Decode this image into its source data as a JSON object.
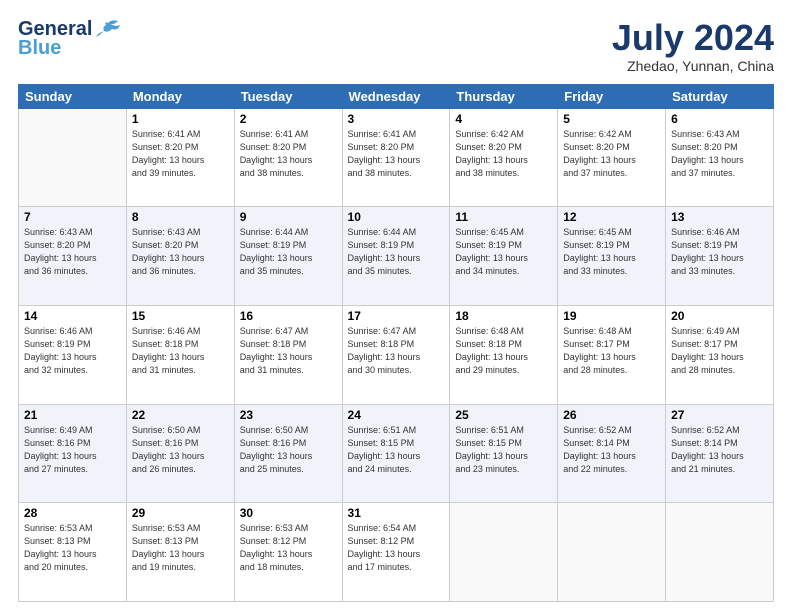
{
  "header": {
    "logo_line1": "General",
    "logo_line2": "Blue",
    "month_title": "July 2024",
    "location": "Zhedao, Yunnan, China"
  },
  "days_of_week": [
    "Sunday",
    "Monday",
    "Tuesday",
    "Wednesday",
    "Thursday",
    "Friday",
    "Saturday"
  ],
  "weeks": [
    [
      {
        "day": "",
        "info": ""
      },
      {
        "day": "1",
        "info": "Sunrise: 6:41 AM\nSunset: 8:20 PM\nDaylight: 13 hours\nand 39 minutes."
      },
      {
        "day": "2",
        "info": "Sunrise: 6:41 AM\nSunset: 8:20 PM\nDaylight: 13 hours\nand 38 minutes."
      },
      {
        "day": "3",
        "info": "Sunrise: 6:41 AM\nSunset: 8:20 PM\nDaylight: 13 hours\nand 38 minutes."
      },
      {
        "day": "4",
        "info": "Sunrise: 6:42 AM\nSunset: 8:20 PM\nDaylight: 13 hours\nand 38 minutes."
      },
      {
        "day": "5",
        "info": "Sunrise: 6:42 AM\nSunset: 8:20 PM\nDaylight: 13 hours\nand 37 minutes."
      },
      {
        "day": "6",
        "info": "Sunrise: 6:43 AM\nSunset: 8:20 PM\nDaylight: 13 hours\nand 37 minutes."
      }
    ],
    [
      {
        "day": "7",
        "info": "Sunrise: 6:43 AM\nSunset: 8:20 PM\nDaylight: 13 hours\nand 36 minutes."
      },
      {
        "day": "8",
        "info": "Sunrise: 6:43 AM\nSunset: 8:20 PM\nDaylight: 13 hours\nand 36 minutes."
      },
      {
        "day": "9",
        "info": "Sunrise: 6:44 AM\nSunset: 8:19 PM\nDaylight: 13 hours\nand 35 minutes."
      },
      {
        "day": "10",
        "info": "Sunrise: 6:44 AM\nSunset: 8:19 PM\nDaylight: 13 hours\nand 35 minutes."
      },
      {
        "day": "11",
        "info": "Sunrise: 6:45 AM\nSunset: 8:19 PM\nDaylight: 13 hours\nand 34 minutes."
      },
      {
        "day": "12",
        "info": "Sunrise: 6:45 AM\nSunset: 8:19 PM\nDaylight: 13 hours\nand 33 minutes."
      },
      {
        "day": "13",
        "info": "Sunrise: 6:46 AM\nSunset: 8:19 PM\nDaylight: 13 hours\nand 33 minutes."
      }
    ],
    [
      {
        "day": "14",
        "info": "Sunrise: 6:46 AM\nSunset: 8:19 PM\nDaylight: 13 hours\nand 32 minutes."
      },
      {
        "day": "15",
        "info": "Sunrise: 6:46 AM\nSunset: 8:18 PM\nDaylight: 13 hours\nand 31 minutes."
      },
      {
        "day": "16",
        "info": "Sunrise: 6:47 AM\nSunset: 8:18 PM\nDaylight: 13 hours\nand 31 minutes."
      },
      {
        "day": "17",
        "info": "Sunrise: 6:47 AM\nSunset: 8:18 PM\nDaylight: 13 hours\nand 30 minutes."
      },
      {
        "day": "18",
        "info": "Sunrise: 6:48 AM\nSunset: 8:18 PM\nDaylight: 13 hours\nand 29 minutes."
      },
      {
        "day": "19",
        "info": "Sunrise: 6:48 AM\nSunset: 8:17 PM\nDaylight: 13 hours\nand 28 minutes."
      },
      {
        "day": "20",
        "info": "Sunrise: 6:49 AM\nSunset: 8:17 PM\nDaylight: 13 hours\nand 28 minutes."
      }
    ],
    [
      {
        "day": "21",
        "info": "Sunrise: 6:49 AM\nSunset: 8:16 PM\nDaylight: 13 hours\nand 27 minutes."
      },
      {
        "day": "22",
        "info": "Sunrise: 6:50 AM\nSunset: 8:16 PM\nDaylight: 13 hours\nand 26 minutes."
      },
      {
        "day": "23",
        "info": "Sunrise: 6:50 AM\nSunset: 8:16 PM\nDaylight: 13 hours\nand 25 minutes."
      },
      {
        "day": "24",
        "info": "Sunrise: 6:51 AM\nSunset: 8:15 PM\nDaylight: 13 hours\nand 24 minutes."
      },
      {
        "day": "25",
        "info": "Sunrise: 6:51 AM\nSunset: 8:15 PM\nDaylight: 13 hours\nand 23 minutes."
      },
      {
        "day": "26",
        "info": "Sunrise: 6:52 AM\nSunset: 8:14 PM\nDaylight: 13 hours\nand 22 minutes."
      },
      {
        "day": "27",
        "info": "Sunrise: 6:52 AM\nSunset: 8:14 PM\nDaylight: 13 hours\nand 21 minutes."
      }
    ],
    [
      {
        "day": "28",
        "info": "Sunrise: 6:53 AM\nSunset: 8:13 PM\nDaylight: 13 hours\nand 20 minutes."
      },
      {
        "day": "29",
        "info": "Sunrise: 6:53 AM\nSunset: 8:13 PM\nDaylight: 13 hours\nand 19 minutes."
      },
      {
        "day": "30",
        "info": "Sunrise: 6:53 AM\nSunset: 8:12 PM\nDaylight: 13 hours\nand 18 minutes."
      },
      {
        "day": "31",
        "info": "Sunrise: 6:54 AM\nSunset: 8:12 PM\nDaylight: 13 hours\nand 17 minutes."
      },
      {
        "day": "",
        "info": ""
      },
      {
        "day": "",
        "info": ""
      },
      {
        "day": "",
        "info": ""
      }
    ]
  ]
}
